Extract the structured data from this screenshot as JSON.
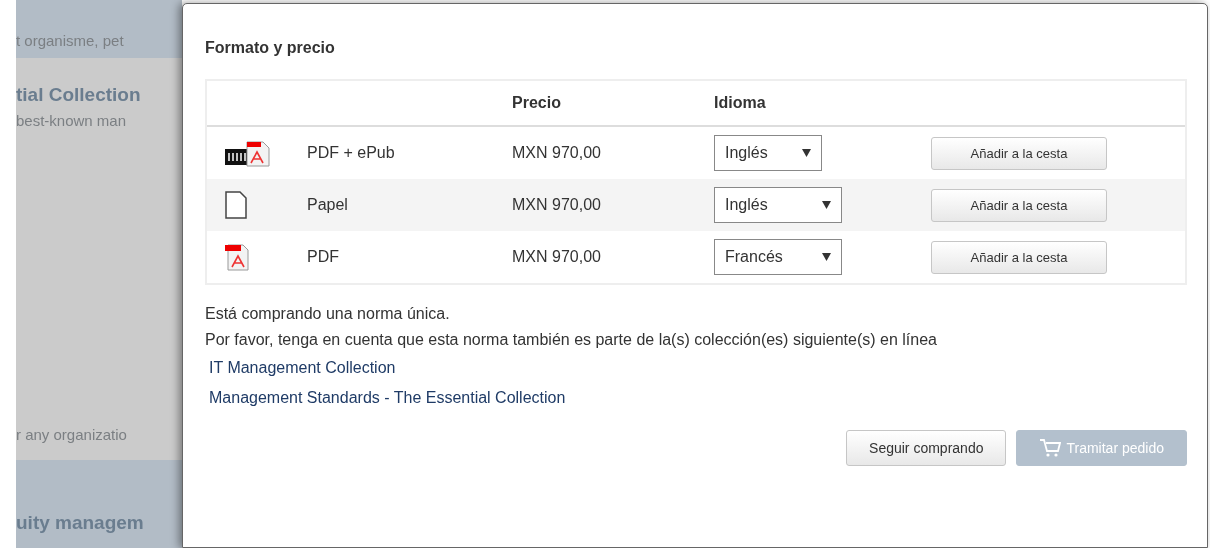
{
  "background": {
    "texts": [
      {
        "kind": "plain",
        "text": "t organisme, pet"
      },
      {
        "kind": "heading",
        "text": "tial Collection"
      },
      {
        "kind": "plain",
        "text": "best-known man"
      },
      {
        "kind": "plain",
        "text": "r any organizatio"
      },
      {
        "kind": "heading",
        "text": "uity managem"
      }
    ]
  },
  "dialog": {
    "title": "Formato y precio",
    "table": {
      "columns": [
        "Precio",
        "Idioma"
      ],
      "rows": [
        {
          "kind": "epub-pdf",
          "format": "PDF + ePub",
          "price": "MXN 970,00",
          "language": "Inglés",
          "button": "Añadir a la cesta"
        },
        {
          "kind": "paper",
          "format": "Papel",
          "price": "MXN 970,00",
          "language": "Inglés",
          "button": "Añadir a la cesta"
        },
        {
          "kind": "pdf",
          "format": "PDF",
          "price": "MXN 970,00",
          "language": "Francés",
          "button": "Añadir a la cesta"
        }
      ]
    },
    "notice": "Está comprando una norma única.",
    "note": "Por favor, tenga en cuenta que esta norma también es parte de la(s) colección(es) siguiente(s) en línea",
    "links": [
      "IT Management Collection",
      "Management Standards - The Essential Collection"
    ],
    "buttons": [
      {
        "kind": "continue",
        "label": "Seguir comprando",
        "disabled": false
      },
      {
        "kind": "checkout",
        "label": "Tramitar pedido",
        "disabled": true
      }
    ]
  }
}
